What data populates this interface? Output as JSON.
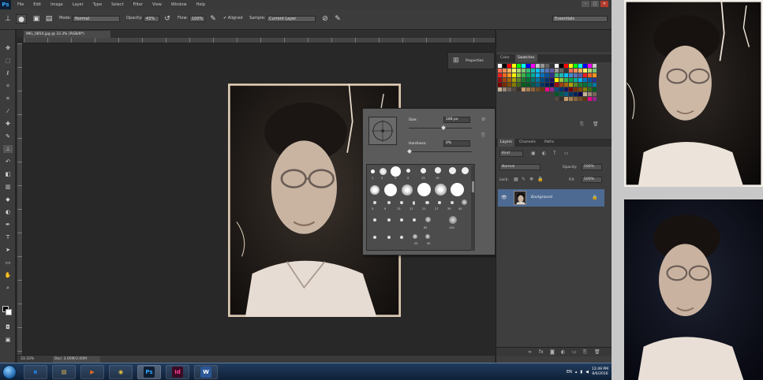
{
  "menubar": {
    "logo": "Ps",
    "items": [
      "File",
      "Edit",
      "Image",
      "Layer",
      "Type",
      "Select",
      "Filter",
      "View",
      "Window",
      "Help"
    ],
    "window_buttons": [
      "–",
      "□",
      "✕"
    ]
  },
  "options_bar": {
    "mode_label": "Mode:",
    "mode_value": "Normal",
    "opacity_label": "Opacity:",
    "opacity_value": "43%",
    "flow_label": "Flow:",
    "flow_value": "100%",
    "aligned_label": "Aligned",
    "sample_label": "Sample:",
    "sample_value": "Current Layer",
    "workspace_value": "Essentials"
  },
  "document": {
    "tab_title": "IMG_0854.jpg @ 33.3% (RGB/8*)",
    "zoom": "33.33%",
    "doc_info": "Doc: 3.00M/3.00M"
  },
  "brush_picker": {
    "size_label": "Size:",
    "size_value": "188 px",
    "hardness_label": "Hardness:",
    "hardness_value": "0%",
    "numbers": [
      "1",
      "3",
      "5",
      "9",
      "13",
      "19",
      "5",
      "9",
      "13",
      "17",
      "21",
      "27",
      "35",
      "45",
      "65",
      "100",
      "200",
      "300",
      "25",
      "50"
    ]
  },
  "properties_chip": {
    "label": "Properties"
  },
  "panels": {
    "swatch_tabs": [
      "Color",
      "Swatches"
    ],
    "layer_tabs": [
      "Layers",
      "Channels",
      "Paths"
    ],
    "kind_label": "Kind",
    "blend_mode": "Normal",
    "opacity_label": "Opacity:",
    "opacity_value": "100%",
    "lock_label": "Lock:",
    "fill_label": "Fill:",
    "fill_value": "100%",
    "layer_name": "Background",
    "swatch_colors": [
      "#ffffff",
      "#000000",
      "#ff0000",
      "#ffff00",
      "#00ff00",
      "#00ffff",
      "#0000ff",
      "#ff00ff",
      "#c8c8c8",
      "#969696",
      "#646464",
      "#323232",
      "#f26c4f",
      "#f68e56",
      "#fbaf5c",
      "#fff467",
      "#acd372",
      "#7cc576",
      "#3bb878",
      "#1abbb4",
      "#00bff3",
      "#438ccb",
      "#5574b9",
      "#605ca8",
      "#ed1c24",
      "#f26522",
      "#f7941d",
      "#fff200",
      "#8dc63f",
      "#39b54a",
      "#00a651",
      "#00a99d",
      "#00aeef",
      "#0072bc",
      "#0054a6",
      "#2e3192",
      "#9e0b0f",
      "#a0410d",
      "#a36209",
      "#aba000",
      "#598527",
      "#197b30",
      "#007236",
      "#00746b",
      "#0076a3",
      "#004b80",
      "#003471",
      "#1b1464",
      "#790000",
      "#7b2e00",
      "#7d4900",
      "#827b00",
      "#406618",
      "#005e20",
      "#005826",
      "#005952",
      "#005b7f",
      "#003663",
      "#002157",
      "#0d004c",
      "#c7b299",
      "#998675",
      "#736357",
      "#534741",
      "#37302a",
      "#c69c6d",
      "#a67c52",
      "#8c6239",
      "#754c24",
      "#603913",
      "#ec008c",
      "#92278f"
    ]
  },
  "taskbar": {
    "apps": [
      {
        "label": "e",
        "color": "#1e90ff",
        "name": "ie"
      },
      {
        "label": "▤",
        "color": "#f2c14e",
        "name": "explorer"
      },
      {
        "label": "▶",
        "color": "#e86b1c",
        "name": "media-player"
      },
      {
        "label": "◉",
        "color": "#e8c33a",
        "name": "chrome"
      },
      {
        "label": "Ps",
        "color": "#31a8ff",
        "name": "photoshop"
      },
      {
        "label": "Id",
        "color": "#ff3f94",
        "name": "indesign"
      },
      {
        "label": "W",
        "color": "#2b5797",
        "name": "word"
      }
    ],
    "lang": "EN",
    "time": "12:49 PM",
    "date": "8/6/2016"
  }
}
